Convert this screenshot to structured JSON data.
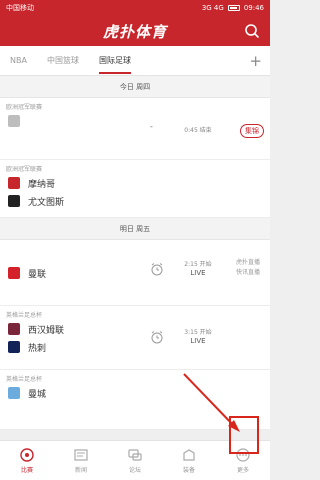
{
  "status_bar": {
    "carrier": "中国移动",
    "network": "3G 4G",
    "battery": "",
    "time": "09:46"
  },
  "app": {
    "logo": "虎扑体育"
  },
  "tabs": {
    "items": [
      "NBA",
      "中国篮球",
      "国际足球"
    ],
    "add_label": "+"
  },
  "content": {
    "date1": "今日 周四",
    "date2": "明日 周五",
    "m1": {
      "round": "欧洲冠军联赛",
      "home": "",
      "away": "",
      "score": "-",
      "time": "0:45 结束",
      "badge": "集锦"
    },
    "m2": {
      "round": "欧洲冠军联赛",
      "home": "摩纳哥",
      "away": "尤文图斯",
      "time": "",
      "side": ""
    },
    "m3": {
      "round": "",
      "home": "曼联",
      "away": "",
      "time": "2:15 开始",
      "live": "LIVE",
      "side1": "虎扑直播",
      "side2": "快讯直播"
    },
    "m4": {
      "round": "英格兰足总杯",
      "home": "西汉姆联",
      "away": "热刺",
      "time": "3:15 开始",
      "live": "LIVE"
    },
    "m5": {
      "round": "英格兰足总杯",
      "home": "曼城"
    }
  },
  "bottom_nav": [
    {
      "label": "比赛",
      "icon": "match-icon"
    },
    {
      "label": "新闻",
      "icon": "news-icon"
    },
    {
      "label": "论坛",
      "icon": "forum-icon"
    },
    {
      "label": "装备",
      "icon": "gear-icon"
    },
    {
      "label": "更多",
      "icon": "more-icon"
    }
  ],
  "colors": {
    "brand": "#c8262d",
    "highlight": "#d9261c"
  }
}
